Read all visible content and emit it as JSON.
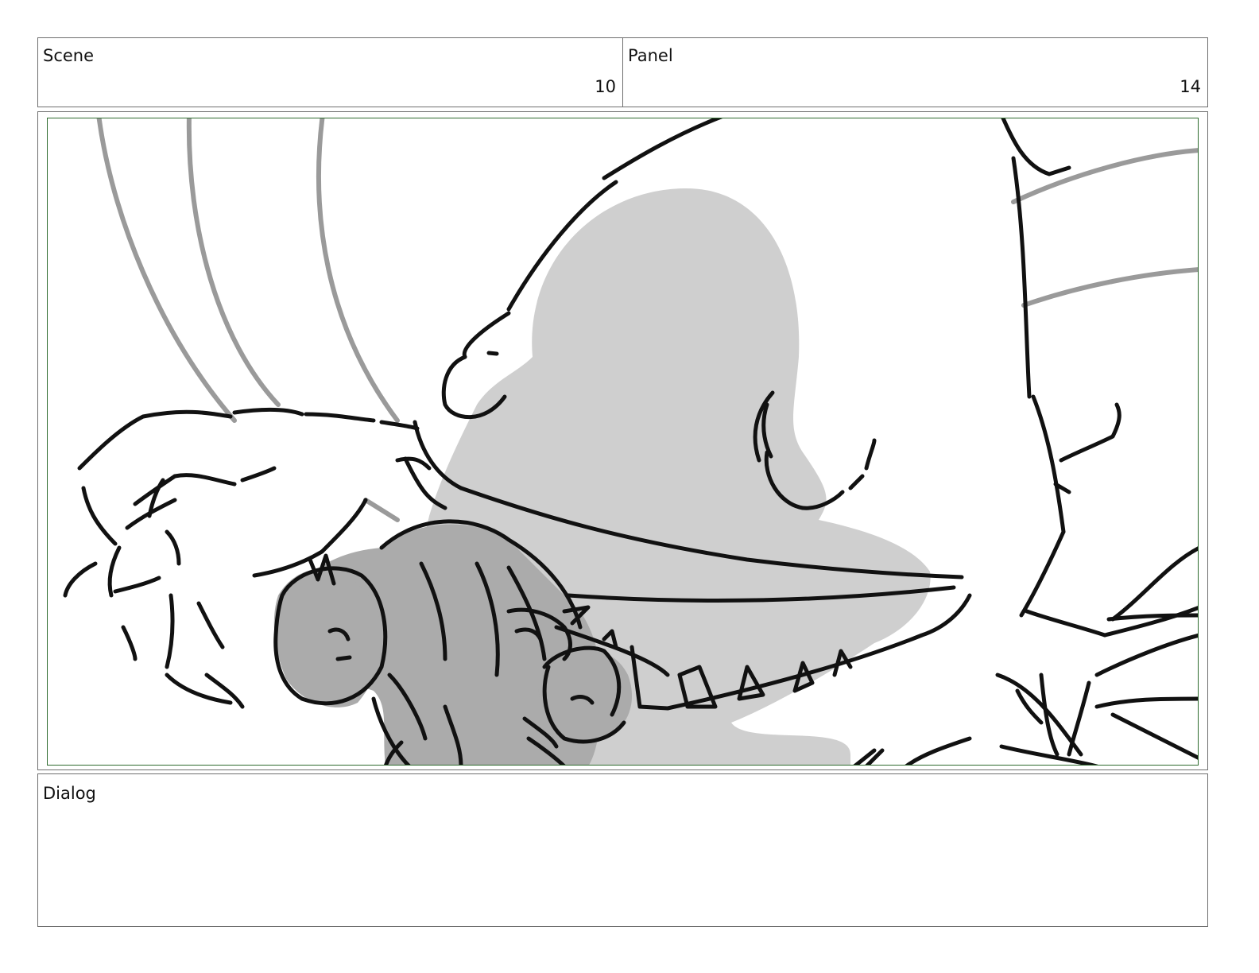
{
  "header": {
    "scene_label": "Scene",
    "scene_value": "10",
    "panel_label": "Panel",
    "panel_value": "14"
  },
  "frame": {
    "safe_area_color": "#2e6b2e",
    "line_color": "#111111",
    "motion_line_color": "#9a9a9a",
    "tone_light": "#cfcfcf",
    "tone_mid": "#ababab"
  },
  "dialog": {
    "label": "Dialog",
    "text": ""
  }
}
